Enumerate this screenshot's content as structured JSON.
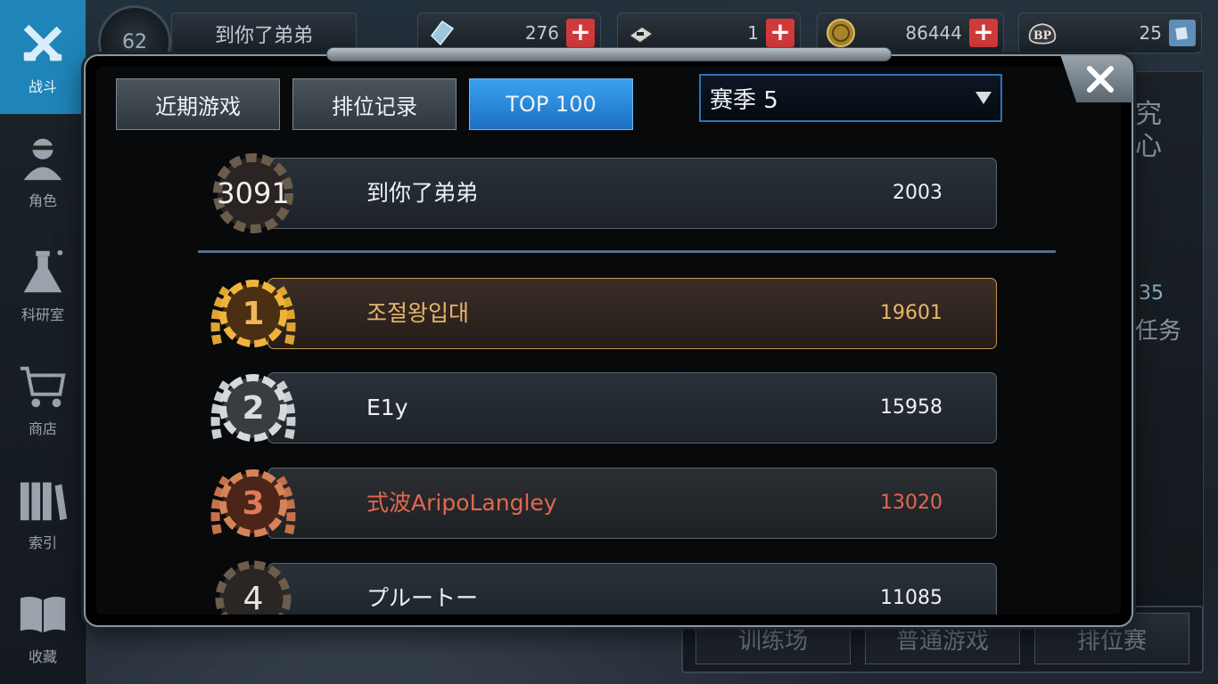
{
  "sidebar": {
    "items": [
      {
        "label": "战斗",
        "icon": "crossed-guns-icon",
        "active": true
      },
      {
        "label": "角色",
        "icon": "character-portrait-icon",
        "active": false
      },
      {
        "label": "科研室",
        "icon": "flask-icon",
        "active": false
      },
      {
        "label": "商店",
        "icon": "shopping-cart-icon",
        "active": false
      },
      {
        "label": "索引",
        "icon": "books-icon",
        "active": false
      },
      {
        "label": "收藏",
        "icon": "open-book-icon",
        "active": false
      }
    ]
  },
  "header": {
    "level": "62",
    "player_name": "到你了弟弟",
    "resources": [
      {
        "name": "crystal",
        "icon": "crystal-icon",
        "value": "276"
      },
      {
        "name": "ticket",
        "icon": "ticket-icon",
        "value": "1"
      },
      {
        "name": "coin",
        "icon": "coin-icon",
        "value": "86444"
      },
      {
        "name": "bp",
        "icon": "bp-icon",
        "value": "25"
      }
    ]
  },
  "background_panel": {
    "right_text_top": "究心",
    "right_counter": "35",
    "right_text_bottom": "任务",
    "bottom_tabs": [
      "训练场",
      "普通游戏",
      "排位赛"
    ]
  },
  "modal": {
    "tabs": [
      {
        "label": "近期游戏",
        "active": false
      },
      {
        "label": "排位记录",
        "active": false
      },
      {
        "label": "TOP 100",
        "active": true
      }
    ],
    "season_selected": "赛季 5",
    "self_entry": {
      "rank": "3091",
      "name": "到你了弟弟",
      "score": "2003"
    },
    "entries": [
      {
        "rank": "1",
        "name": "조절왕입대",
        "score": "19601",
        "tier": "gold"
      },
      {
        "rank": "2",
        "name": "E1y",
        "score": "15958",
        "tier": "silver"
      },
      {
        "rank": "3",
        "name": "式波AripoLangley",
        "score": "13020",
        "tier": "bronze"
      },
      {
        "rank": "4",
        "name": "プルートー",
        "score": "11085",
        "tier": "iron"
      }
    ]
  },
  "colors": {
    "accent_blue": "#1f84b8",
    "tab_active": "#2b8ee0",
    "gold": "#e7b66a",
    "bronze": "#e3674d",
    "plus_red": "#d23a3a"
  }
}
